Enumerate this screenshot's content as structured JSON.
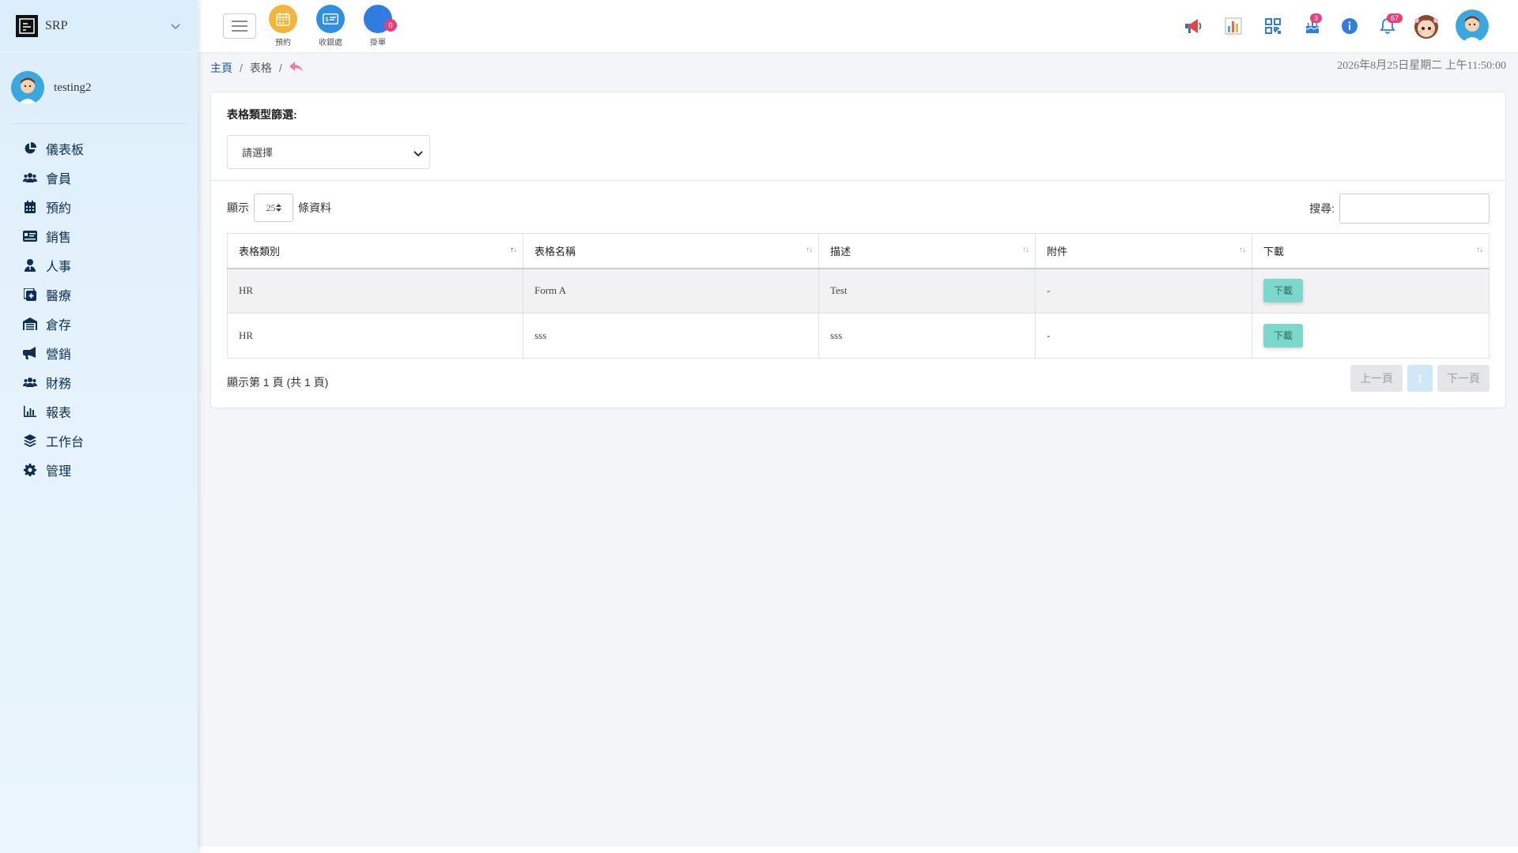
{
  "brand": {
    "name": "SRP"
  },
  "user": {
    "name": "testing2"
  },
  "sidebar": {
    "items": [
      {
        "label": "儀表板",
        "icon": "pie-chart-icon"
      },
      {
        "label": "會員",
        "icon": "users-icon"
      },
      {
        "label": "預約",
        "icon": "calendar-icon"
      },
      {
        "label": "銷售",
        "icon": "id-card-icon"
      },
      {
        "label": "人事",
        "icon": "user-tie-icon"
      },
      {
        "label": "醫療",
        "icon": "medical-icon"
      },
      {
        "label": "倉存",
        "icon": "warehouse-icon"
      },
      {
        "label": "營銷",
        "icon": "megaphone-icon"
      },
      {
        "label": "財務",
        "icon": "users-icon"
      },
      {
        "label": "報表",
        "icon": "bar-chart-icon"
      },
      {
        "label": "工作台",
        "icon": "layers-icon"
      },
      {
        "label": "管理",
        "icon": "gear-icon"
      }
    ]
  },
  "topbar": {
    "quick": [
      {
        "label": "預約",
        "color": "#f4b53a"
      },
      {
        "label": "收銀處",
        "color": "#2f8fe0"
      },
      {
        "label": "掛單",
        "color": "#2f7de0",
        "badge": "0"
      }
    ],
    "badges": {
      "cake": "3",
      "bell": "67"
    }
  },
  "breadcrumb": {
    "home": "主頁",
    "current": "表格"
  },
  "datetime": "2026年8月25日星期二 上午11:50:00",
  "filter": {
    "label": "表格類型篩選:",
    "placeholder": "請選擇"
  },
  "table": {
    "length_prefix": "顯示",
    "length_value": "25",
    "length_suffix": "條資料",
    "search_label": "搜尋:",
    "columns": [
      "表格類別",
      "表格名稱",
      "描述",
      "附件",
      "下載"
    ],
    "rows": [
      {
        "category": "HR",
        "name": "Form A",
        "desc": "Test",
        "attachment": "-",
        "download": "下載"
      },
      {
        "category": "HR",
        "name": "sss",
        "desc": "sss",
        "attachment": "-",
        "download": "下載"
      }
    ],
    "page_info": "顯示第 1 頁 (共 1 頁)",
    "prev": "上一頁",
    "page": "1",
    "next": "下一頁"
  }
}
